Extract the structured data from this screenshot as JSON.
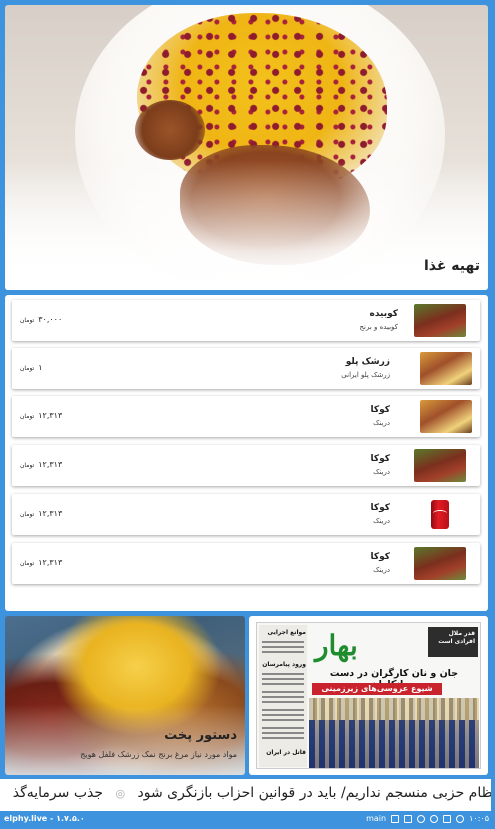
{
  "hero": {
    "title": "تهیه غذا"
  },
  "menu": {
    "items": [
      {
        "name": "کوبیده",
        "desc": "کوبیده و برنج",
        "price": "۳۰,۰۰۰",
        "currency": "تومان",
        "thumb": "kabob"
      },
      {
        "name": "زرشک پلو",
        "desc": "زرشک پلو ایرانی",
        "price": "۱",
        "currency": "تومان",
        "thumb": "polo"
      },
      {
        "name": "کوکا",
        "desc": "درینک",
        "price": "۱۲,۳۱۳",
        "currency": "تومان",
        "thumb": "polo"
      },
      {
        "name": "کوکا",
        "desc": "درینک",
        "price": "۱۲,۳۱۳",
        "currency": "تومان",
        "thumb": "kabob"
      },
      {
        "name": "کوکا",
        "desc": "درینک",
        "price": "۱۲,۳۱۳",
        "currency": "تومان",
        "thumb": "coke"
      },
      {
        "name": "کوکا",
        "desc": "درینک",
        "price": "۱۲,۳۱۳",
        "currency": "تومان",
        "thumb": "kabob"
      }
    ]
  },
  "recipe_card": {
    "title": "دستور پخت",
    "subtitle": "مواد مورد نیاز مرغ برنج نمک زرشک فلفل هویج"
  },
  "newspaper_card": {
    "logo": "بهار",
    "headline": "جان و نان کارگران در دست پیمانکاران",
    "banner": "شیوع عروسی‌های زیرزمینی",
    "box_text": "قدر ملال افرادی است",
    "side_headlines": [
      "موانع اجرایی",
      "ورود پیامرسان",
      "قاتل در ایران"
    ]
  },
  "ticker": {
    "text_main": "نظام حزبی منسجم نداریم/ باید در قوانین احزاب بازنگری شود",
    "separator_icon": "rss-icon",
    "text_next": "جذب سرمایه‌گذ"
  },
  "status_bar": {
    "site": "elphy.live - ۱.۷.۵.۰",
    "label": "main",
    "time": "۱۰:۰۵"
  },
  "colors": {
    "accent": "#3e93de"
  }
}
